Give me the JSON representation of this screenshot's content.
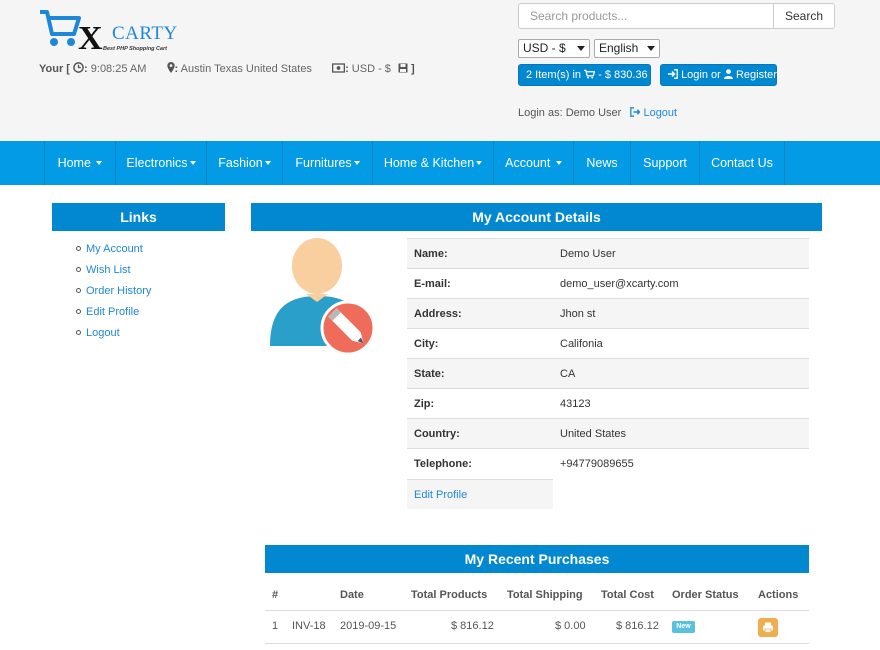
{
  "header": {
    "logo": {
      "x": "X",
      "carty": "CARTY",
      "tagline": "Best PHP Shopping Cart"
    },
    "info": {
      "your_label": "Your [",
      "time": "9:08:25 AM",
      "location": "Austin Texas United States",
      "currency": "USD - $",
      "close_bracket": "]"
    },
    "search": {
      "placeholder": "Search products...",
      "button_label": "Search"
    },
    "currency_select": "USD - $",
    "language_select": "English",
    "cart_button": {
      "items_text": "2 Item(s) in",
      "amount": "- $ 830.36"
    },
    "login_button": {
      "login": "Login",
      "or": "or",
      "register": "Register"
    },
    "login_as": "Login as: Demo User",
    "logout": "Logout"
  },
  "nav": {
    "items": [
      {
        "label": "Home",
        "caret": true
      },
      {
        "label": "Electronics",
        "caret": true
      },
      {
        "label": "Fashion",
        "caret": true
      },
      {
        "label": "Furnitures",
        "caret": true
      },
      {
        "label": "Home & Kitchen",
        "caret": true
      },
      {
        "label": "Account",
        "caret": true
      },
      {
        "label": "News",
        "caret": false
      },
      {
        "label": "Support",
        "caret": false
      },
      {
        "label": "Contact Us",
        "caret": false
      }
    ]
  },
  "sidebar": {
    "title": "Links",
    "links": [
      "My Account",
      "Wish List",
      "Order History",
      "Edit Profile",
      "Logout"
    ]
  },
  "account": {
    "title": "My Account Details",
    "rows": [
      {
        "label": "Name:",
        "value": "Demo User"
      },
      {
        "label": "E-mail:",
        "value": "demo_user@xcarty.com"
      },
      {
        "label": "Address:",
        "value": "Jhon st"
      },
      {
        "label": "City:",
        "value": "Califonia"
      },
      {
        "label": "State:",
        "value": "CA"
      },
      {
        "label": "Zip:",
        "value": "43123"
      },
      {
        "label": "Country:",
        "value": "United States"
      },
      {
        "label": "Telephone:",
        "value": "+94779089655"
      }
    ],
    "edit_profile": "Edit Profile"
  },
  "purchases": {
    "title": "My Recent Purchases",
    "headers": [
      "#",
      "Date",
      "Total Products",
      "Total Shipping",
      "Total Cost",
      "Order Status",
      "Actions"
    ],
    "rows": [
      {
        "num": "1",
        "invoice": "INV-18",
        "date": "2019-09-15",
        "products": "$ 816.12",
        "shipping": "$ 0.00",
        "cost": "$ 816.12",
        "status": "New"
      }
    ]
  },
  "colors": {
    "primary": "#0288d1",
    "nav": "#039be5",
    "link": "#1e88d6",
    "badge": "#5bc0de",
    "print": "#f0ad4e"
  }
}
